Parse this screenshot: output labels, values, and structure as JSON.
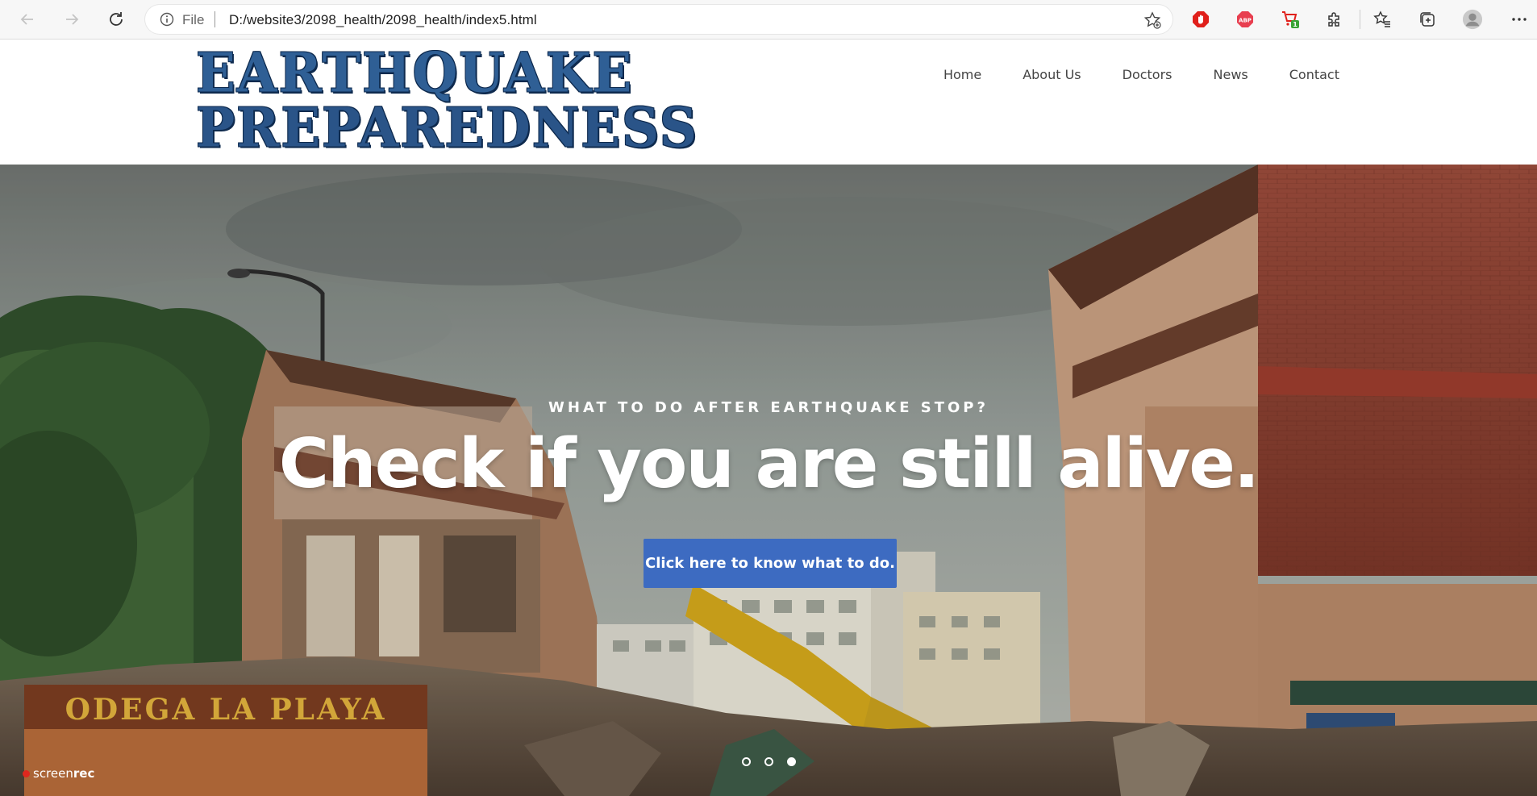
{
  "browser": {
    "address": {
      "scheme_label": "File",
      "url": "D:/website3/2098_health/2098_health/index5.html"
    },
    "extensions": [
      {
        "icon": "adblocker-stop-icon",
        "color": "#e0201b"
      },
      {
        "icon": "abp-icon",
        "color": "#e83e4f",
        "label": "ABP"
      },
      {
        "icon": "shopping-extension-icon",
        "color": "#e0201b",
        "badge": "1"
      },
      {
        "icon": "puzzle-extensions-icon"
      },
      {
        "icon": "favorites-icon"
      },
      {
        "icon": "collections-icon"
      },
      {
        "icon": "profile-avatar-icon"
      },
      {
        "icon": "more-menu-icon"
      }
    ]
  },
  "site": {
    "logo": {
      "line1": "EARTHQUAKE",
      "line2": "PREPAREDNESS",
      "color": "#2f5f95"
    },
    "nav": [
      "Home",
      "About Us",
      "Doctors",
      "News",
      "Contact"
    ]
  },
  "hero": {
    "kicker": "WHAT TO DO AFTER EARTHQUAKE STOP?",
    "title": "Check if you are still alive.",
    "cta": "Click here to know what to do.",
    "cta_color": "#3d6bc1",
    "slides": {
      "count": 3,
      "active": 3
    },
    "background_sign": "ODEGA LA PLAYA"
  },
  "watermark": {
    "text_light": "screen",
    "text_bold": "rec"
  }
}
